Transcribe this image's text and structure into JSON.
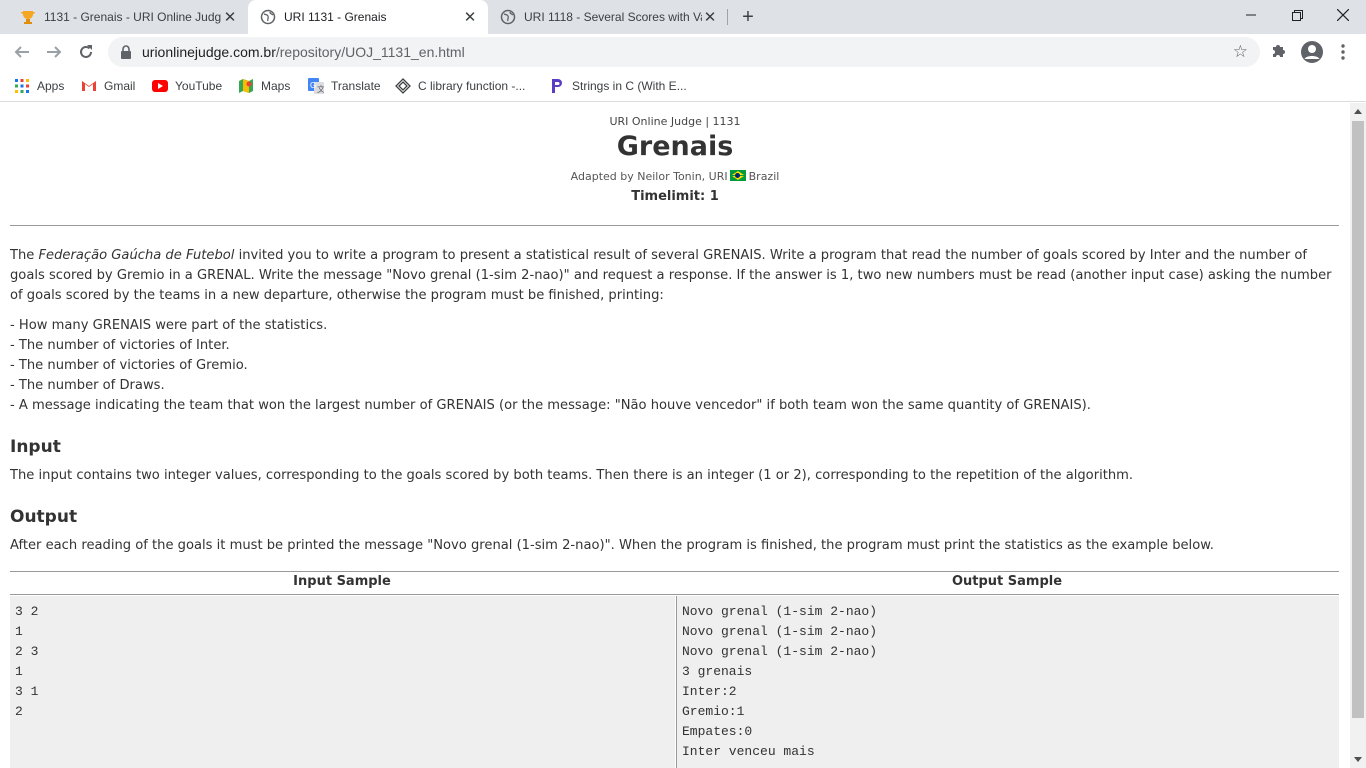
{
  "browser": {
    "tabs": [
      {
        "title": "1131 - Grenais - URI Online Judg",
        "favicon": "uri-trophy-icon",
        "active": false
      },
      {
        "title": "URI 1131 - Grenais",
        "favicon": "globe-icon",
        "active": true
      },
      {
        "title": "URI 1118 - Several Scores with Va",
        "favicon": "globe-icon",
        "active": false
      }
    ],
    "new_tab": "+",
    "window_controls": {
      "minimize": "—",
      "maximize": "❐",
      "close": "✕"
    },
    "url": {
      "host": "urionlinejudge.com.br",
      "path": "/repository/UOJ_1131_en.html"
    },
    "bookmarks": [
      {
        "label": "Apps",
        "icon": "apps-grid-icon"
      },
      {
        "label": "Gmail",
        "icon": "gmail-icon"
      },
      {
        "label": "YouTube",
        "icon": "youtube-icon"
      },
      {
        "label": "Maps",
        "icon": "maps-icon"
      },
      {
        "label": "Translate",
        "icon": "translate-icon"
      },
      {
        "label": "C library function -...",
        "icon": "c-library-icon"
      },
      {
        "label": "Strings in C (With E...",
        "icon": "programiz-icon"
      }
    ]
  },
  "problem": {
    "breadcrumb": "URI Online Judge | 1131",
    "title": "Grenais",
    "adapted_by": "Adapted by Neilor Tonin, URI",
    "country": "Brazil",
    "timelimit": "Timelimit: 1",
    "description_pre": "The ",
    "description_italic": "Federação Gaúcha de Futebol",
    "description_post": " invited you to write a program to present a statistical result of several GRENAIS. Write a program that read the number of goals scored by Inter and the number of goals scored by Gremio in a GRENAL. Write the message \"Novo grenal (1-sim 2-nao)\" and request a response. If the answer is 1, two new numbers must be read (another input case) asking the number of goals scored by the teams in a new departure, otherwise the program must be finished, printing:",
    "list": [
      "- How many GRENAIS were part of the statistics.",
      "- The number of victories of Inter.",
      "- The number of victories of Gremio.",
      "- The number of Draws.",
      "- A message indicating the team that won the largest number of GRENAIS (or the message: \"Não houve vencedor\" if both team won the same quantity of GRENAIS)."
    ],
    "input_heading": "Input",
    "input_text": "The input contains two integer values, corresponding to the goals scored by both teams. Then there is an integer (1 or 2), corresponding to the repetition of the algorithm.",
    "output_heading": "Output",
    "output_text": "After each reading of the goals it must be printed the message \"Novo grenal (1-sim 2-nao)\". When the program is finished, the program must print the statistics as the example below.",
    "input_sample_heading": "Input Sample",
    "output_sample_heading": "Output Sample",
    "input_sample": [
      "3 2",
      "1",
      "2 3",
      "1",
      "3 1",
      "2"
    ],
    "output_sample": [
      "Novo grenal (1-sim 2-nao)",
      "Novo grenal (1-sim 2-nao)",
      "Novo grenal (1-sim 2-nao)",
      "3 grenais",
      "Inter:2",
      "Gremio:1",
      "Empates:0",
      "Inter venceu mais"
    ]
  }
}
